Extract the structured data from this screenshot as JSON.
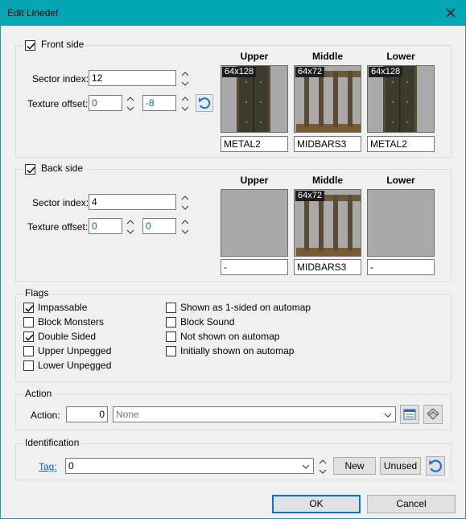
{
  "window": {
    "title": "Edit Linedef"
  },
  "front": {
    "legend": "Front side",
    "checked": true,
    "sector_label": "Sector index:",
    "sector_value": "12",
    "offset_label": "Texture offset:",
    "offset_x": "0",
    "offset_y": "-8",
    "headers": [
      "Upper",
      "Middle",
      "Lower"
    ],
    "textures": [
      {
        "size": "64x128",
        "name": "METAL2",
        "kind": "metal"
      },
      {
        "size": "64x72",
        "name": "MIDBARS3",
        "kind": "bars"
      },
      {
        "size": "64x128",
        "name": "METAL2",
        "kind": "metal"
      }
    ]
  },
  "back": {
    "legend": "Back side",
    "checked": true,
    "sector_label": "Sector index:",
    "sector_value": "4",
    "offset_label": "Texture offset:",
    "offset_x": "0",
    "offset_y": "0",
    "headers": [
      "Upper",
      "Middle",
      "Lower"
    ],
    "textures": [
      {
        "size": "",
        "name": "-",
        "kind": "empty"
      },
      {
        "size": "64x72",
        "name": "MIDBARS3",
        "kind": "bars"
      },
      {
        "size": "",
        "name": "-",
        "kind": "empty"
      }
    ]
  },
  "flags": {
    "legend": "Flags",
    "left": [
      {
        "label": "Impassable",
        "checked": true
      },
      {
        "label": "Block Monsters",
        "checked": false
      },
      {
        "label": "Double Sided",
        "checked": true
      },
      {
        "label": "Upper Unpegged",
        "checked": false
      },
      {
        "label": "Lower Unpegged",
        "checked": false
      }
    ],
    "right": [
      {
        "label": "Shown as 1-sided on automap",
        "checked": false
      },
      {
        "label": "Block Sound",
        "checked": false
      },
      {
        "label": "Not shown on automap",
        "checked": false
      },
      {
        "label": "Initially shown on automap",
        "checked": false
      }
    ]
  },
  "action": {
    "legend": "Action",
    "label": "Action:",
    "number": "0",
    "combo": "None"
  },
  "identification": {
    "legend": "Identification",
    "tag_label": "Tag:",
    "tag_value": "0",
    "new_label": "New",
    "unused_label": "Unused"
  },
  "buttons": {
    "ok": "OK",
    "cancel": "Cancel"
  },
  "colors": {
    "titlebar": "#00a8b5",
    "link": "#0b61c4",
    "accent": "#0078d7"
  }
}
